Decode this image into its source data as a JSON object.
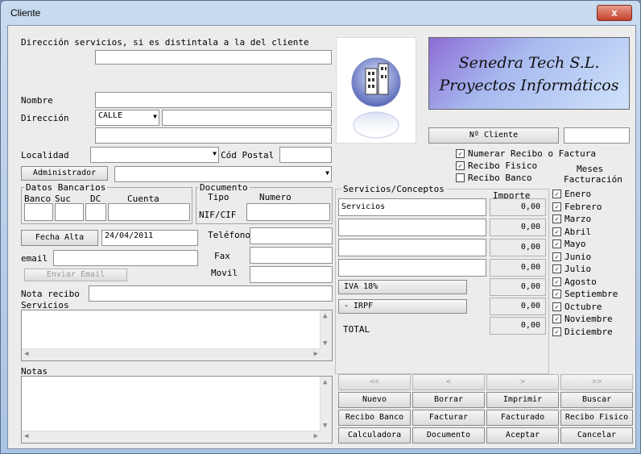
{
  "window": {
    "title": "Cliente",
    "close_glyph": "x"
  },
  "address_services": {
    "label": "Dirección servicios, si es distintala a la del cliente",
    "value": ""
  },
  "company": {
    "line1": "Senedra Tech S.L.",
    "line2": "Proyectos Informáticos"
  },
  "client_no": {
    "button": "Nº Cliente",
    "value": ""
  },
  "name": {
    "label": "Nombre",
    "value": ""
  },
  "address": {
    "label": "Dirección",
    "street_type": "CALLE",
    "value": "",
    "line2": ""
  },
  "locality": {
    "label": "Localidad",
    "value": "",
    "postal_label": "Cód Postal",
    "postal_value": ""
  },
  "administrator": {
    "button": "Administrador",
    "value": ""
  },
  "options": {
    "numerar": {
      "label": "Numerar Recibo o Factura",
      "checked": true
    },
    "recibo_fisico": {
      "label": "Recibo Fisico",
      "checked": true
    },
    "recibo_banco": {
      "label": "Recibo Banco",
      "checked": false
    }
  },
  "months": {
    "header1": "Meses",
    "header2": "Facturación",
    "items": [
      {
        "label": "Enero"
      },
      {
        "label": "Febrero"
      },
      {
        "label": "Marzo"
      },
      {
        "label": "Abril"
      },
      {
        "label": "Mayo"
      },
      {
        "label": "Junio"
      },
      {
        "label": "Julio"
      },
      {
        "label": "Agosto"
      },
      {
        "label": "Septiembre"
      },
      {
        "label": "Octubre"
      },
      {
        "label": "Noviembre"
      },
      {
        "label": "Diciembre"
      }
    ]
  },
  "bank": {
    "group": "Datos Bancarios",
    "banco": "Banco",
    "suc": "Suc",
    "dc": "DC",
    "cuenta": "Cuenta"
  },
  "document": {
    "group": "Documento",
    "tipo": "Tipo",
    "numero": "Numero",
    "tipo_value": "NIF/CIF",
    "numero_value": ""
  },
  "alta": {
    "button": "Fecha Alta",
    "value": "24/04/2011"
  },
  "email": {
    "label": "email",
    "value": "",
    "send_button": "Enviar Email"
  },
  "phones": {
    "telefono": "Teléfono",
    "fax": "Fax",
    "movil": "Movil"
  },
  "nota_recibo": {
    "label": "Nota recibo",
    "value": ""
  },
  "servicios_memo": {
    "label": "Servicios"
  },
  "notas_memo": {
    "label": "Notas"
  },
  "services_group": {
    "title": "Servicios/Conceptos",
    "importe": "Importe",
    "rows": [
      {
        "concept": "Servicios",
        "amount": "0,00"
      },
      {
        "concept": "",
        "amount": "0,00"
      },
      {
        "concept": "",
        "amount": "0,00"
      },
      {
        "concept": "",
        "amount": "0,00"
      }
    ],
    "iva": {
      "label": "IVA 18%",
      "amount": "0,00"
    },
    "irpf": {
      "label": "- IRPF",
      "amount": "0,00"
    },
    "total": {
      "label": "TOTAL",
      "amount": "0,00"
    }
  },
  "nav": {
    "first": "<<",
    "prev": "<",
    "next": ">",
    "last": ">>"
  },
  "actions": {
    "nuevo": "Nuevo",
    "borrar": "Borrar",
    "imprimir": "Imprimir",
    "buscar": "Buscar",
    "recibo_banco": "Recibo Banco",
    "facturar": "Facturar",
    "facturado": "Facturado",
    "recibo_fisico": "Recibo Fisico",
    "calculadora": "Calculadora",
    "documento": "Documento",
    "aceptar": "Aceptar",
    "cancelar": "Cancelar"
  }
}
